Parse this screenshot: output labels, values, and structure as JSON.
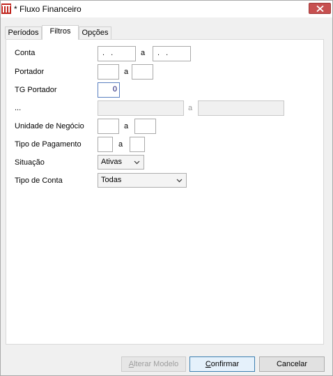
{
  "window": {
    "title": "* Fluxo Financeiro"
  },
  "tabs": [
    {
      "label": "Períodos",
      "active": false
    },
    {
      "label": "Filtros",
      "active": true
    },
    {
      "label": "Opções",
      "active": false
    }
  ],
  "filters": {
    "conta": {
      "label": "Conta",
      "from": ". .",
      "sep": "a",
      "to": ". ."
    },
    "portador": {
      "label": "Portador",
      "from": "",
      "sep": "a",
      "to": ""
    },
    "tg_portador": {
      "label": "TG Portador",
      "value": "0"
    },
    "dots_row": {
      "label": "...",
      "from": "",
      "sep": "a",
      "to": ""
    },
    "unidade": {
      "label": "Unidade de Negócio",
      "from": "",
      "sep": "a",
      "to": ""
    },
    "tipo_pagamento": {
      "label": "Tipo de Pagamento",
      "from": "",
      "sep": "a",
      "to": ""
    },
    "situacao": {
      "label": "Situação",
      "selected": "Ativas"
    },
    "tipo_conta": {
      "label": "Tipo de Conta",
      "selected": "Todas"
    }
  },
  "buttons": {
    "alterar_modelo": {
      "first": "A",
      "rest": "lterar Modelo"
    },
    "confirmar": {
      "first": "C",
      "rest": "onfirmar"
    },
    "cancelar": {
      "label": "Cancelar"
    }
  },
  "colors": {
    "close_button": "#c75050",
    "app_icon": "#c0241c",
    "focus_border": "#3c7fb1"
  },
  "icons": {
    "app": "app-logo-icon",
    "close": "close-icon",
    "dropdown": "chevron-down-icon"
  }
}
